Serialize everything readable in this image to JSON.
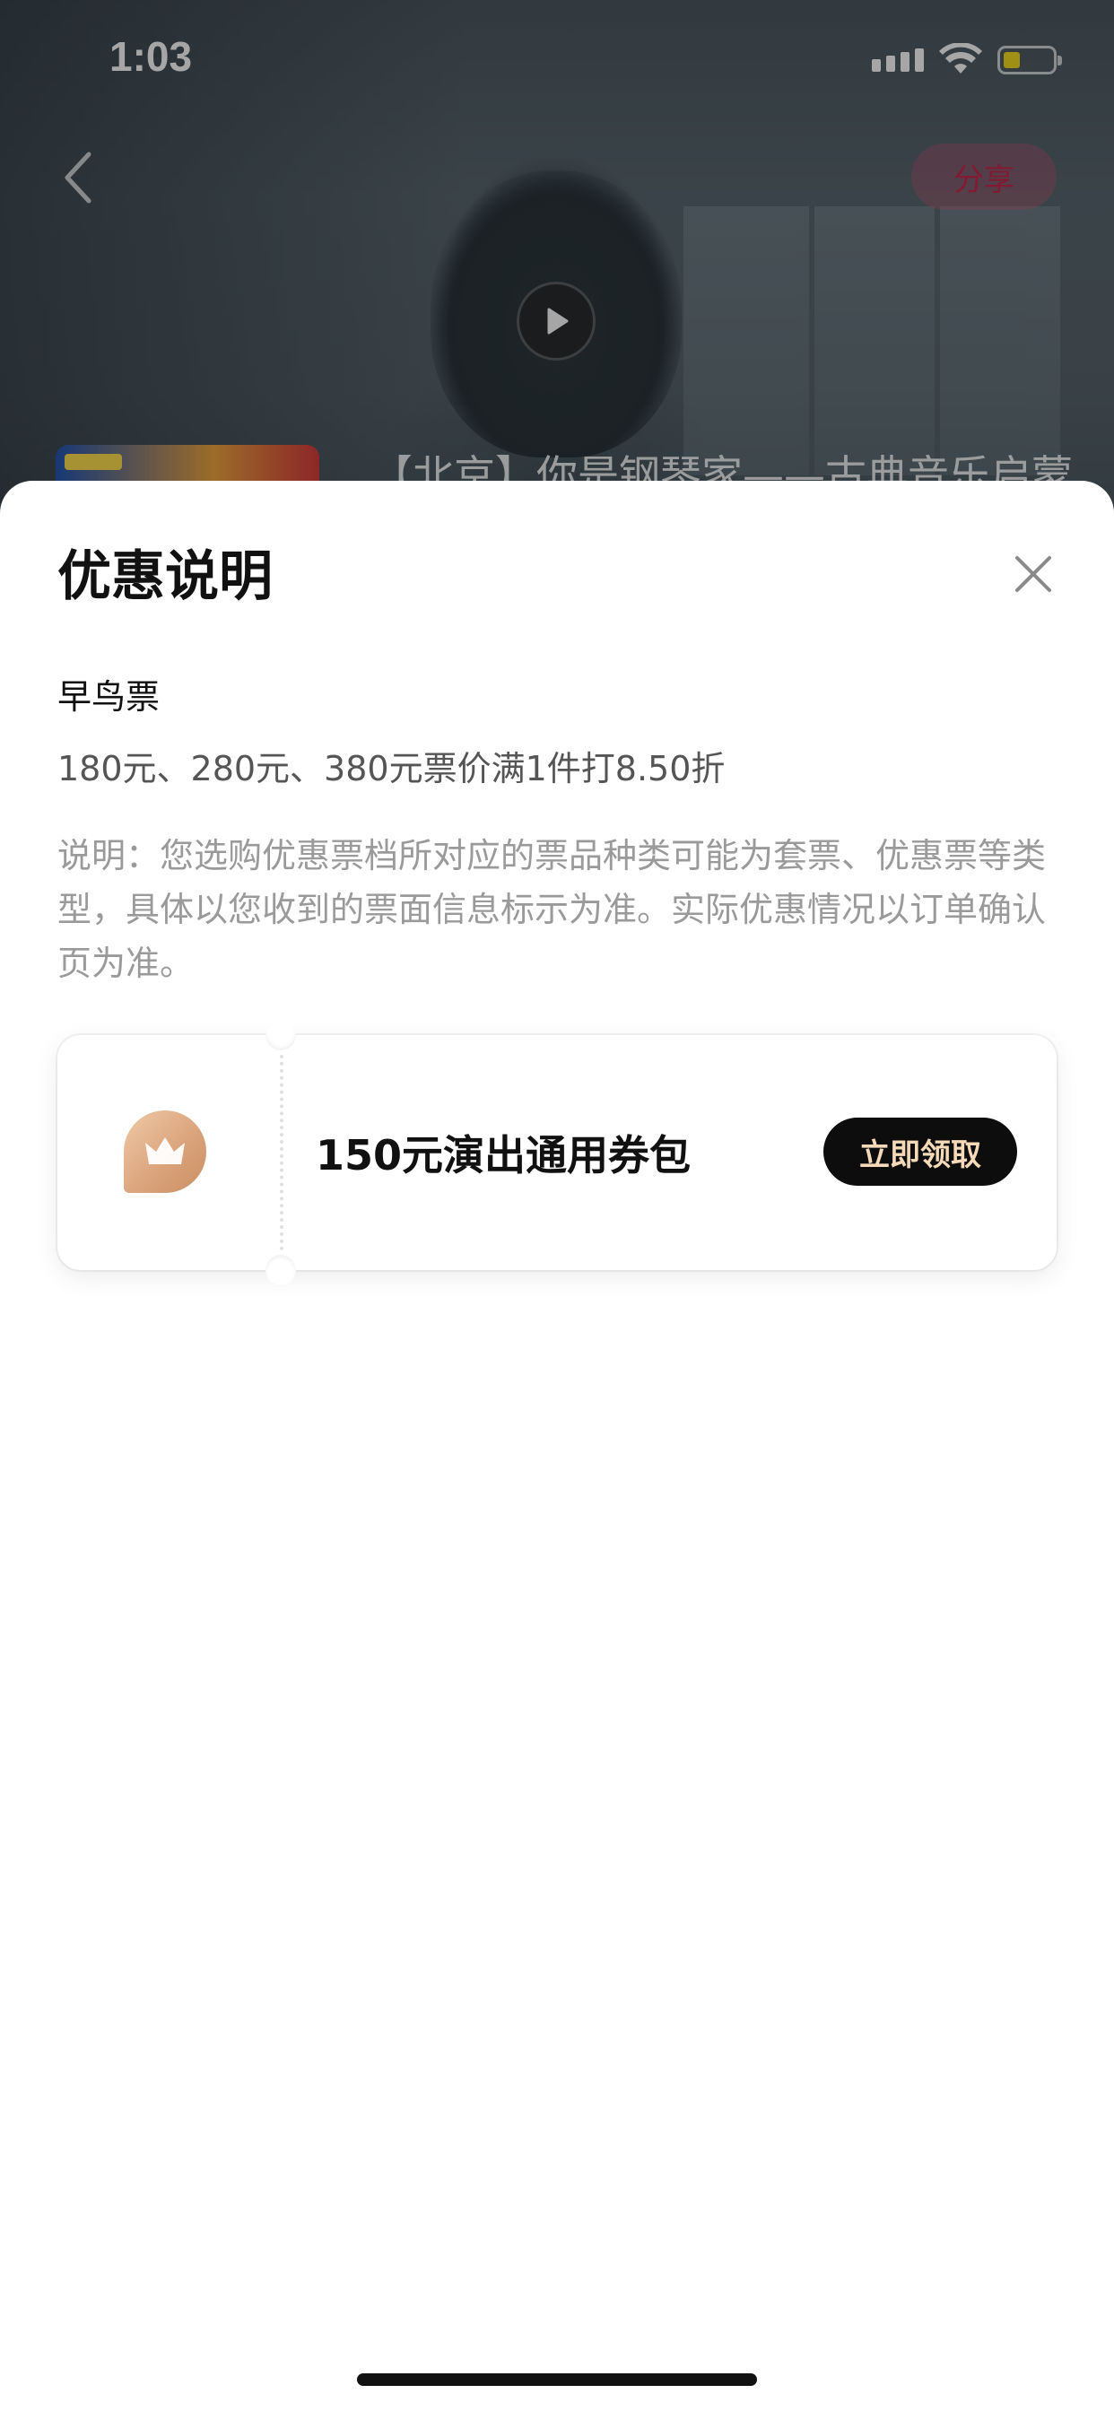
{
  "status_bar": {
    "time": "1:03"
  },
  "header": {
    "share_label": "分享",
    "show_title": "【北京】你是钢琴家——古典音乐启蒙"
  },
  "sheet": {
    "title": "优惠说明",
    "ticket_name": "早鸟票",
    "discount_rule": "180元、280元、380元票价满1件打8.50折",
    "note": "说明：您选购优惠票档所对应的票品种类可能为套票、优惠票等类型，具体以您收到的票面信息标示为准。实际优惠情况以订单确认页为准。",
    "coupon": {
      "name": "150元演出通用券包",
      "claim_label": "立即领取"
    }
  },
  "colors": {
    "share_text": "#c7294d",
    "claim_bg": "#0d0d0d",
    "claim_text": "#f5d9b8",
    "coupon_icon": "#d9a27a",
    "note_text": "#9a9a9a"
  }
}
